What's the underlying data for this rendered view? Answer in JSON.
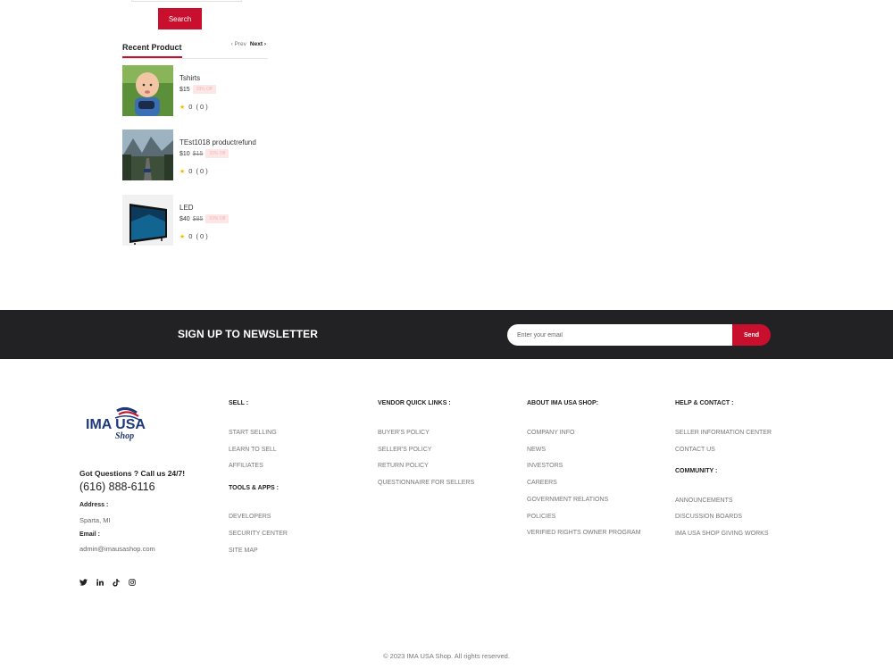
{
  "sidebar": {
    "search_label": "Search",
    "recent_title": "Recent Product",
    "prev_label": "Prev",
    "next_label": "Next",
    "products": [
      {
        "name": "Tshirts",
        "price": "$15",
        "old_price": "",
        "discount": "33% Off",
        "rating": "0",
        "reviews": "( 0 )"
      },
      {
        "name": "TEst1018 productrefund",
        "price": "$10",
        "old_price": "$15",
        "discount": "33% Off",
        "rating": "0",
        "reviews": "( 0 )"
      },
      {
        "name": "LED",
        "price": "$40",
        "old_price": "$85",
        "discount": "53% Off",
        "rating": "0",
        "reviews": "( 0 )"
      }
    ]
  },
  "newsletter": {
    "title": "SIGN UP TO NEWSLETTER",
    "placeholder": "Enter your email",
    "send_label": "Send"
  },
  "footer": {
    "logo_text": "IMA USA",
    "logo_sub": "Shop",
    "questions": "Got Questions ? Call us 24/7!",
    "phone": "(616) 888-6116",
    "address_label": "Address :",
    "address": "Sparta, MI",
    "email_label": "Email :",
    "email": "admin@imausashop.com",
    "sell": {
      "title": "SELL :",
      "links": [
        "START SELLING",
        "LEARN TO SELL",
        "AFFILIATES"
      ]
    },
    "tools": {
      "title": "TOOLS & APPS :",
      "links": [
        "DEVELOPERS",
        "SECURITY CENTER",
        "SITE MAP"
      ]
    },
    "vendor": {
      "title": "VENDOR QUICK LINKS :",
      "links": [
        "BUYER'S POLICY",
        "SELLER'S POLICY",
        "RETURN POLICY",
        "QUESTIONNAIRE FOR SELLERS"
      ]
    },
    "about": {
      "title": "ABOUT IMA USA SHOP:",
      "links": [
        "COMPANY INFO",
        "NEWS",
        "INVESTORS",
        "CAREERS",
        "GOVERNMENT RELATIONS",
        "POLICIES",
        "VERIFIED RIGHTS OWNER PROGRAM"
      ]
    },
    "help": {
      "title": "HELP & CONTACT :",
      "links": [
        "SELLER INFORMATION CENTER",
        "CONTACT US"
      ]
    },
    "community": {
      "title": "COMMUNITY :",
      "links": [
        "ANNOUNCEMENTS",
        "DISCUSSION BOARDS",
        "IMA USA SHOP GIVING WORKS"
      ]
    },
    "copyright": "© 2023 IMA USA Shop. All rights reserved."
  },
  "colors": {
    "accent": "#c8102e",
    "newsletter_bg": "#222225",
    "discount_bg": "#fde6e6"
  },
  "icons": [
    "twitter-icon",
    "linkedin-icon",
    "tiktok-icon",
    "instagram-icon",
    "star-icon"
  ]
}
